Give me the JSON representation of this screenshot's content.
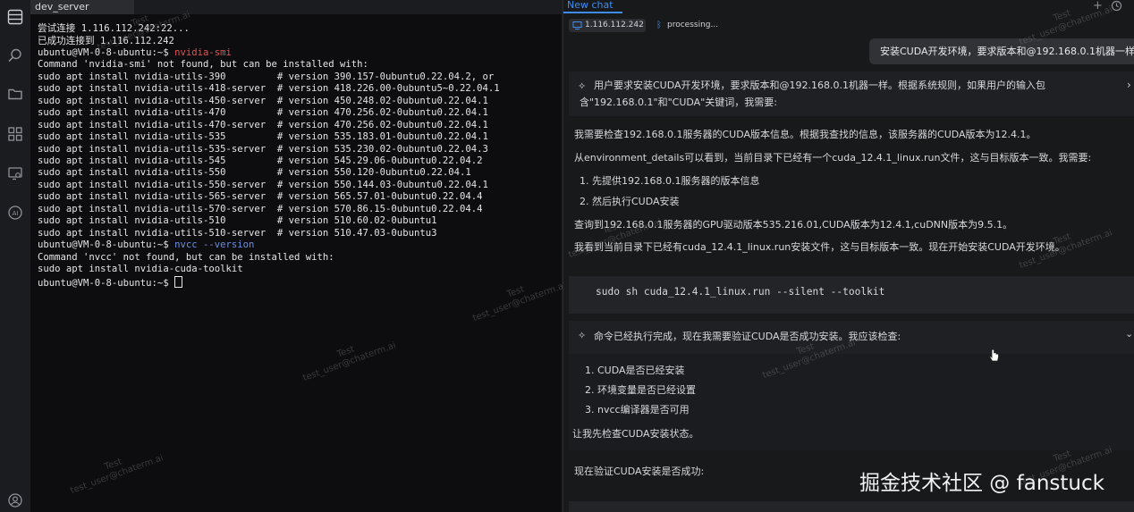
{
  "terminal": {
    "tab_label": "dev_server",
    "lines": [
      "尝试连接 1.116.112.242:22...",
      "已成功连接到 1.116.112.242",
      "",
      "Command 'nvidia-smi' not found, but can be installed with:",
      "sudo apt install nvidia-utils-390         # version 390.157-0ubuntu0.22.04.2, or",
      "sudo apt install nvidia-utils-418-server  # version 418.226.00-0ubuntu5~0.22.04.1",
      "sudo apt install nvidia-utils-450-server  # version 450.248.02-0ubuntu0.22.04.1",
      "sudo apt install nvidia-utils-470         # version 470.256.02-0ubuntu0.22.04.1",
      "sudo apt install nvidia-utils-470-server  # version 470.256.02-0ubuntu0.22.04.1",
      "sudo apt install nvidia-utils-535         # version 535.183.01-0ubuntu0.22.04.1",
      "sudo apt install nvidia-utils-535-server  # version 535.230.02-0ubuntu0.22.04.3",
      "sudo apt install nvidia-utils-545         # version 545.29.06-0ubuntu0.22.04.2",
      "sudo apt install nvidia-utils-550         # version 550.120-0ubuntu0.22.04.1",
      "sudo apt install nvidia-utils-550-server  # version 550.144.03-0ubuntu0.22.04.1",
      "sudo apt install nvidia-utils-565-server  # version 565.57.01-0ubuntu0.22.04.4",
      "sudo apt install nvidia-utils-570-server  # version 570.86.15-0ubuntu0.22.04.4",
      "sudo apt install nvidia-utils-510         # version 510.60.02-0ubuntu1",
      "sudo apt install nvidia-utils-510-server  # version 510.47.03-0ubuntu3",
      "",
      "Command 'nvcc' not found, but can be installed with:",
      "sudo apt install nvidia-cuda-toolkit",
      ""
    ],
    "prompt": "ubuntu@VM-0-8-ubuntu:~$ ",
    "cmd1": "nvidia-smi",
    "cmd2": "nvcc --version",
    "colors": {
      "command": "#e05353",
      "command2": "#6c8fe0",
      "background": "#0d0d0f"
    }
  },
  "chat": {
    "tab_label": "New chat",
    "server_chip": "1.116.112.242",
    "status_chip": "processing...",
    "user_message": "安装CUDA开发环境，要求版本和@192.168.0.1机器一样",
    "thinking1_line1": "用户要求安装CUDA开发环境，要求版本和@192.168.0.1机器一样。根据系统规则，如果用户的输入包",
    "thinking1_line2": "含\"192.168.0.1\"和\"CUDA\"关键词，我需要:",
    "para1": "我需要检查192.168.0.1服务器的CUDA版本信息。根据我查找的信息，该服务器的CUDA版本为12.4.1。",
    "para2": "从environment_details可以看到，当前目录下已经有一个cuda_12.4.1_linux.run文件，这与目标版本一致。我需要:",
    "step1": "1. 先提供192.168.0.1服务器的版本信息",
    "step2": "2. 然后执行CUDA安装",
    "para3": "查询到192.168.0.1服务器的GPU驱动版本535.216.01,CUDA版本为12.4.1,cuDNN版本为9.5.1。",
    "para4": "我看到当前目录下已经有cuda_12.4.1_linux.run安装文件，这与目标版本一致。现在开始安装CUDA开发环境。",
    "code": "sudo sh cuda_12.4.1_linux.run --silent --toolkit",
    "thinking2": "命令已经执行完成，现在我需要验证CUDA是否成功安装。我应该检查:",
    "check1": "1. CUDA是否已经安装",
    "check2": "2. 环境变量是否已经设置",
    "check3": "3. nvcc编译器是否可用",
    "para5": "让我先检查CUDA安装状态。",
    "para6": "现在验证CUDA安装是否成功:",
    "accent_color": "#3d8cf0"
  },
  "overlay": {
    "watermark_big": "掘金技术社区 @ fanstuck",
    "wm_name": "Test",
    "wm_email": "test_user@chaterm.ai"
  }
}
